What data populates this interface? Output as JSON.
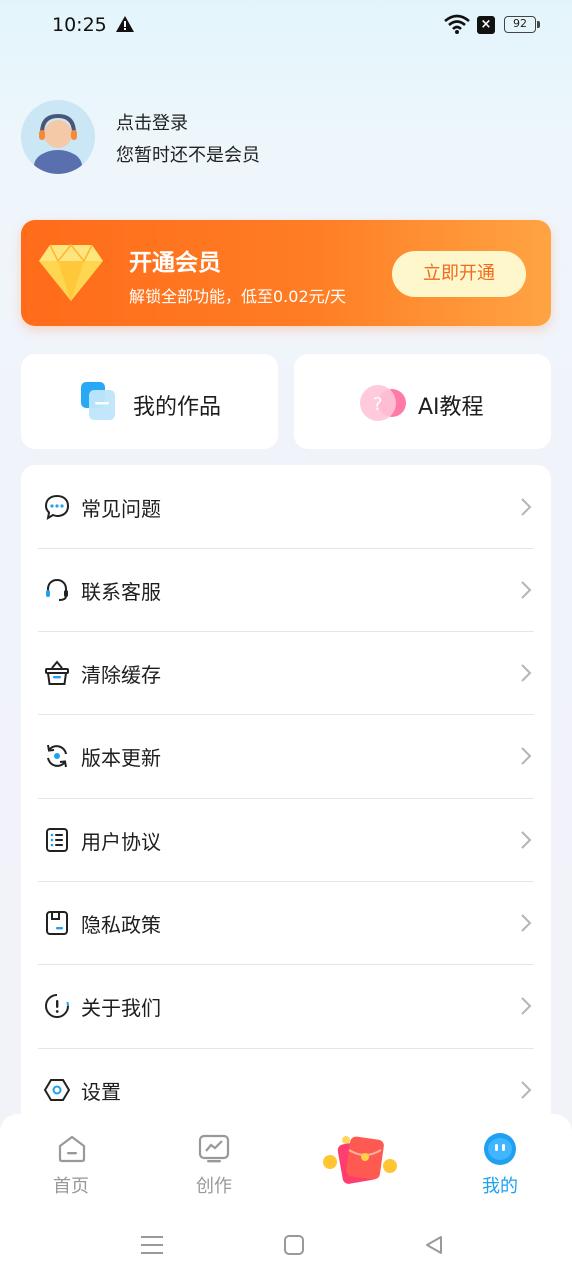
{
  "status_bar": {
    "time": "10:25",
    "battery": "92",
    "icons": [
      "warning-icon",
      "wifi-icon",
      "close-box-icon",
      "battery-icon"
    ]
  },
  "profile": {
    "login_label": "点击登录",
    "membership_status": "您暂时还不是会员"
  },
  "vip_card": {
    "title": "开通会员",
    "subtitle": "解锁全部功能，低至0.02元/天",
    "button_label": "立即开通",
    "accent_color": "#ff6b1a"
  },
  "quick_actions": [
    {
      "label": "我的作品",
      "icon": "works-icon"
    },
    {
      "label": "AI教程",
      "icon": "tutorial-icon"
    }
  ],
  "menu": [
    {
      "label": "常见问题",
      "icon": "chat-bubble-icon"
    },
    {
      "label": "联系客服",
      "icon": "headset-icon"
    },
    {
      "label": "清除缓存",
      "icon": "basket-icon"
    },
    {
      "label": "版本更新",
      "icon": "refresh-icon"
    },
    {
      "label": "用户协议",
      "icon": "list-doc-icon"
    },
    {
      "label": "隐私政策",
      "icon": "save-doc-icon"
    },
    {
      "label": "关于我们",
      "icon": "info-exclaim-icon"
    },
    {
      "label": "设置",
      "icon": "hexagon-gear-icon"
    }
  ],
  "bottom_nav": [
    {
      "label": "首页",
      "icon": "home-icon",
      "active": false
    },
    {
      "label": "创作",
      "icon": "chart-icon",
      "active": false
    },
    {
      "label": "",
      "icon": "red-envelope-icon",
      "active": false
    },
    {
      "label": "我的",
      "icon": "face-icon",
      "active": true
    }
  ],
  "colors": {
    "active_tab": "#1fa0f0",
    "vip_button_text": "#f06a1b"
  }
}
